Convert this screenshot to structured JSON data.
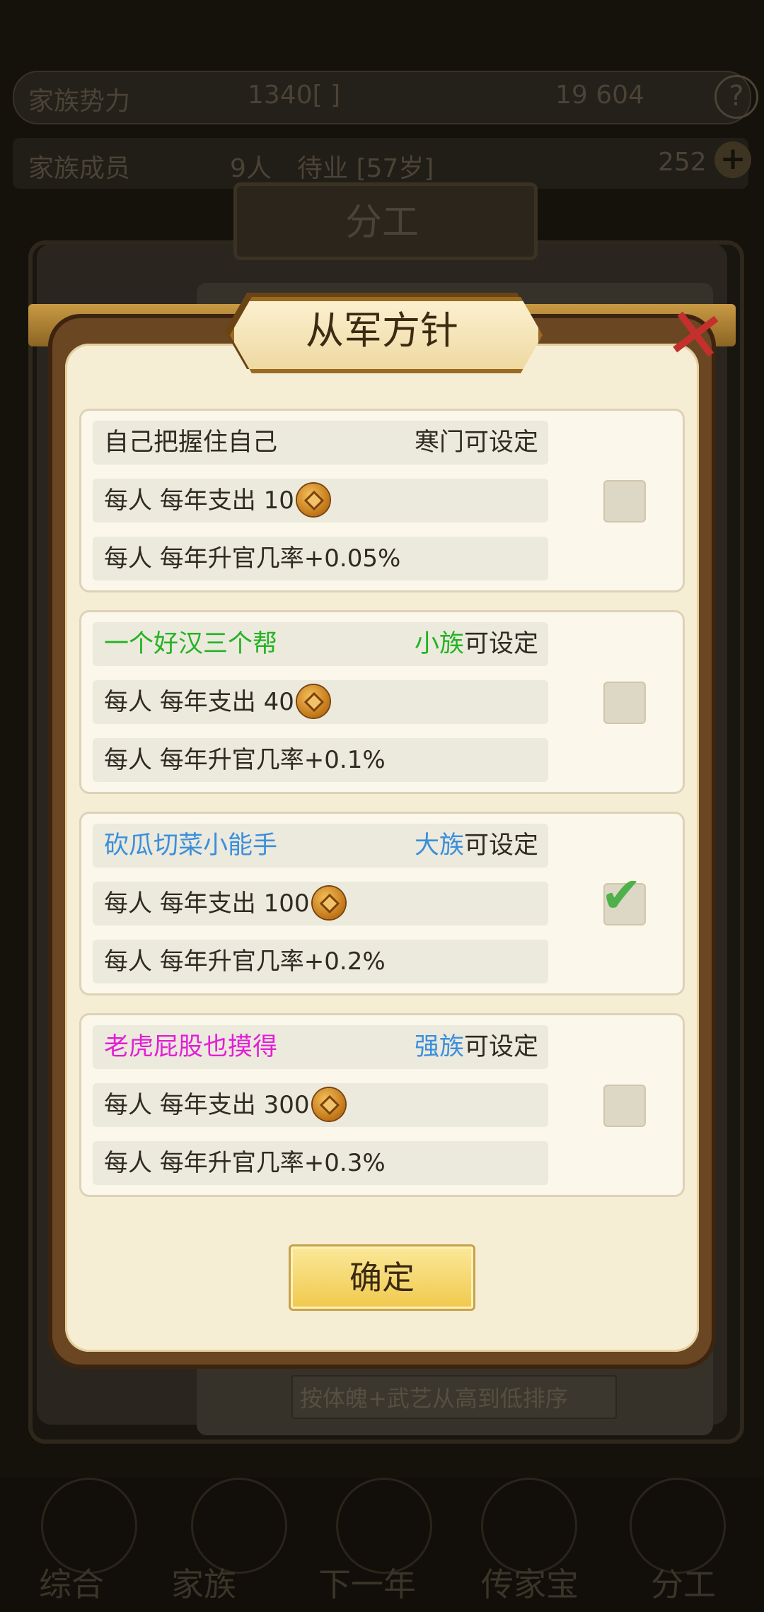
{
  "background": {
    "top_bar": {
      "label": "家族势力",
      "value": "1340[ ]",
      "stats": "19 604"
    },
    "second_bar": {
      "label": "家族成员",
      "count": "9人",
      "status": "待业 [57岁]",
      "money": "252"
    },
    "panel_title": "分工",
    "sort_label": "按体魄+武艺从高到低排序",
    "nav": [
      "综合",
      "家族",
      "下一年",
      "传家宝",
      "分工"
    ]
  },
  "modal": {
    "title": "从军方针",
    "close_symbol": "✕",
    "confirm_label": "确定",
    "options": [
      {
        "name": "自己把握住自己",
        "name_color": "#2f2a22",
        "tier": "寒门",
        "tier_color": "#2f2a22",
        "tier_suffix": "可设定",
        "cost_prefix": "每人 每年支出",
        "cost": "10",
        "rate_text": "每人 每年升官几率+0.05%",
        "checked": false
      },
      {
        "name": "一个好汉三个帮",
        "name_color": "#24b324",
        "tier": "小族",
        "tier_color": "#24b324",
        "tier_suffix": "可设定",
        "cost_prefix": "每人 每年支出",
        "cost": "40",
        "rate_text": "每人 每年升官几率+0.1%",
        "checked": false
      },
      {
        "name": "砍瓜切菜小能手",
        "name_color": "#3a8fdc",
        "tier": "大族",
        "tier_color": "#3a8fdc",
        "tier_suffix": "可设定",
        "cost_prefix": "每人 每年支出",
        "cost": "100",
        "rate_text": "每人 每年升官几率+0.2%",
        "checked": true
      },
      {
        "name": "老虎屁股也摸得",
        "name_color": "#e21fd6",
        "tier": "强族",
        "tier_color": "#3a8fdc",
        "tier_suffix": "可设定",
        "cost_prefix": "每人 每年支出",
        "cost": "300",
        "rate_text": "每人 每年升官几率+0.3%",
        "checked": false
      }
    ]
  }
}
